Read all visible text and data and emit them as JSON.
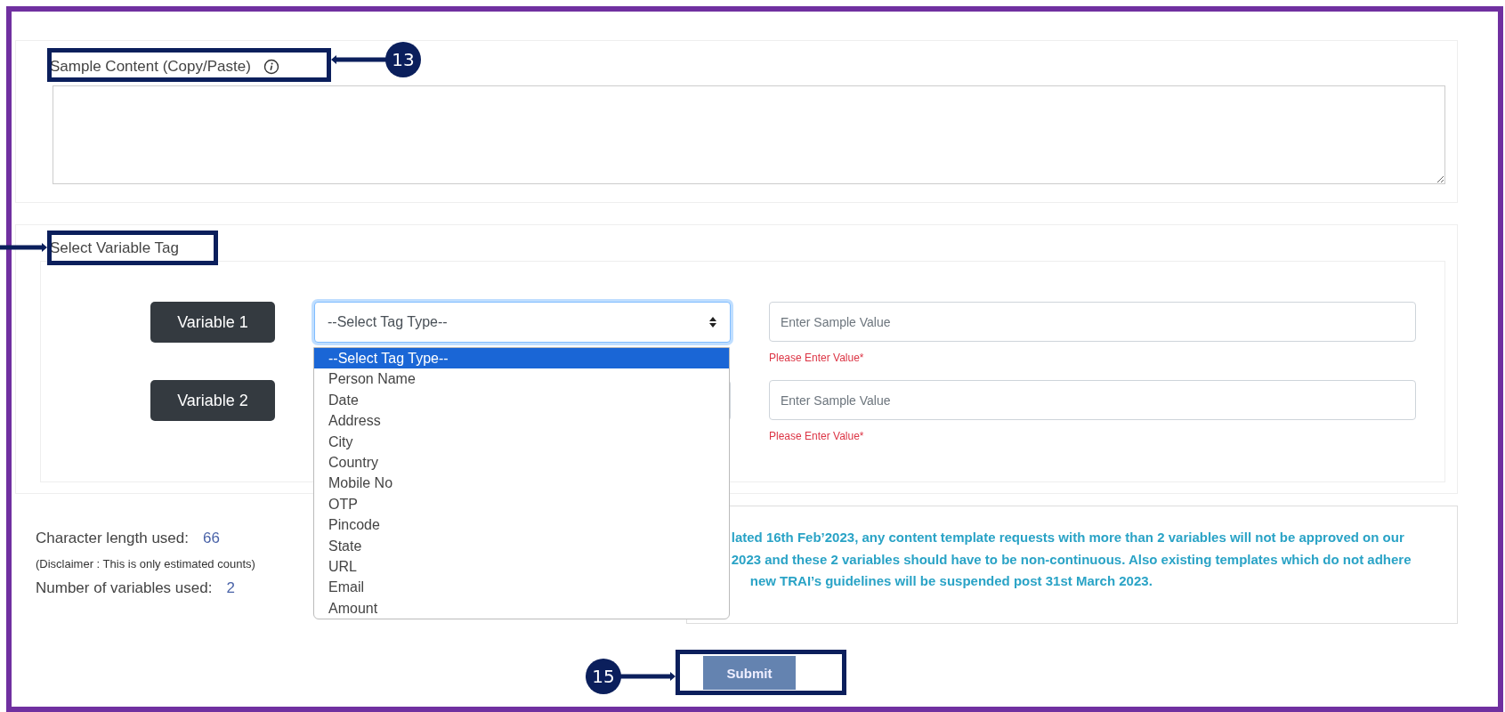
{
  "sample_content": {
    "label": "Sample Content (Copy/Paste)",
    "annotated": true,
    "callout": "13"
  },
  "variable_tag": {
    "label": "Select Variable Tag",
    "annotated": true,
    "variables": [
      {
        "label": "Variable 1",
        "tag_select": {
          "value": "--Select Tag Type--",
          "focused": true,
          "options": [
            {
              "label": "--Select Tag Type--",
              "selected": true
            },
            {
              "label": "Person Name",
              "selected": false
            },
            {
              "label": "Date",
              "selected": false
            },
            {
              "label": "Address",
              "selected": false
            },
            {
              "label": "City",
              "selected": false
            },
            {
              "label": "Country",
              "selected": false
            },
            {
              "label": "Mobile No",
              "selected": false
            },
            {
              "label": "OTP",
              "selected": false
            },
            {
              "label": "Pincode",
              "selected": false
            },
            {
              "label": "State",
              "selected": false
            },
            {
              "label": "URL",
              "selected": false
            },
            {
              "label": "Email",
              "selected": false
            },
            {
              "label": "Amount",
              "selected": false
            }
          ]
        },
        "sample_value": {
          "placeholder": "Enter Sample Value"
        },
        "error": "Please Enter Value*"
      },
      {
        "label": "Variable 2",
        "tag_select": {
          "focused": false
        },
        "sample_value": {
          "placeholder": "Enter Sample Value"
        },
        "error": "Please Enter Value*"
      }
    ]
  },
  "stats": [
    {
      "label": "Character length used:",
      "value": "66"
    },
    {
      "kind": "note",
      "label": "(Disclaimer : This is only estimated counts)"
    },
    {
      "label": "Number of variables used:",
      "value": "2"
    }
  ],
  "notice": {
    "lines": [
      "lated 16th Feb’2023, any content template requests with more than 2 variables will not be approved on our",
      "2023 and these 2 variables should have to be non-continuous. Also existing templates which do not adhere",
      "new TRAI’s guidelines will be suspended post 31st March 2023."
    ]
  },
  "submit": {
    "label": "Submit",
    "annotated": true,
    "callout": "15"
  }
}
